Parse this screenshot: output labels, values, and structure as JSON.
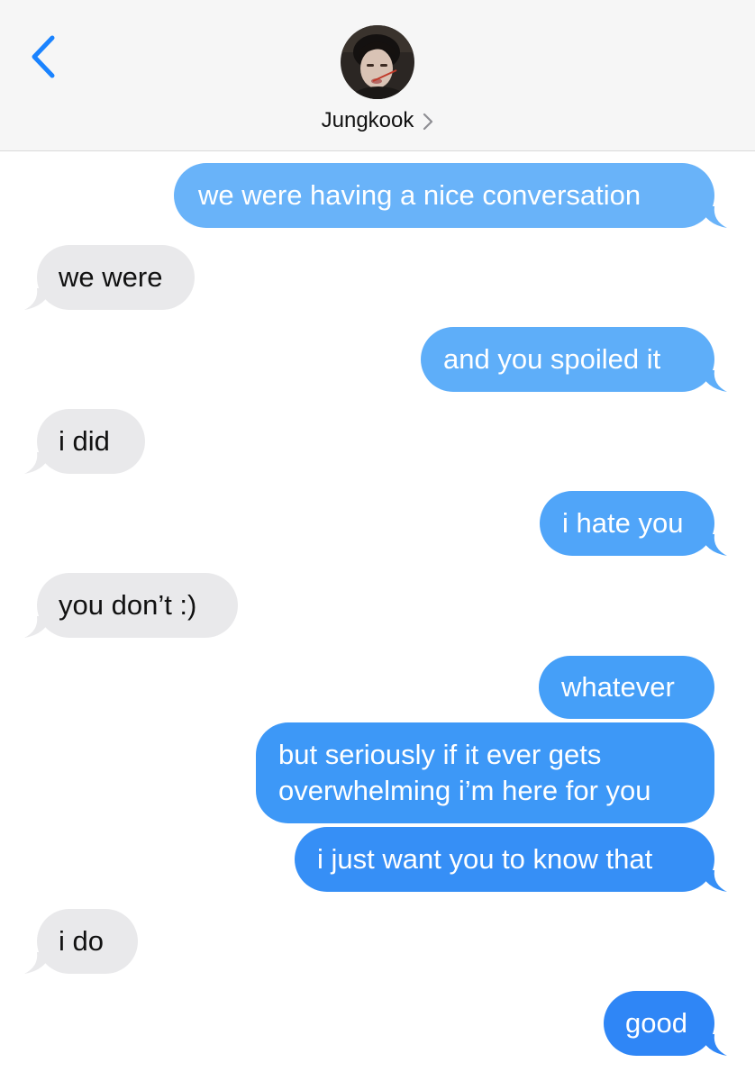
{
  "header": {
    "back_icon": "chevron-left-icon",
    "contact_name": "Jungkook",
    "contact_chevron_icon": "chevron-right-icon",
    "accent_color": "#1a83ff"
  },
  "colors": {
    "sent_top": "#66b2f8",
    "sent_bottom": "#2f86f6",
    "received": "#e9e9eb"
  },
  "messages": [
    {
      "from": "me",
      "text": "we were having a nice conversation"
    },
    {
      "from": "them",
      "text": "we were"
    },
    {
      "from": "me",
      "text": "and you spoiled it"
    },
    {
      "from": "them",
      "text": "i did"
    },
    {
      "from": "me",
      "text": "i hate you"
    },
    {
      "from": "them",
      "text": "you don’t :)"
    },
    {
      "from": "me",
      "text": "whatever"
    },
    {
      "from": "me",
      "line1": "but seriously if it ever gets",
      "line2": "overwhelming i’m here for you"
    },
    {
      "from": "me",
      "text": "i just want you to know that"
    },
    {
      "from": "them",
      "text": "i do"
    },
    {
      "from": "me",
      "text": "good"
    }
  ]
}
